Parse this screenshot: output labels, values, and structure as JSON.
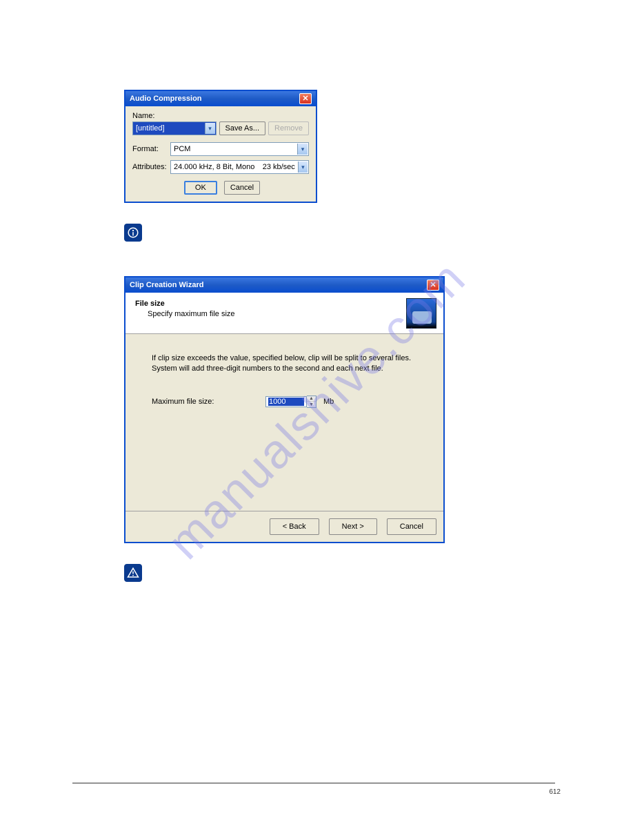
{
  "watermark": "manualshive.com",
  "audio_dialog": {
    "title": "Audio Compression",
    "name_label": "Name:",
    "name_value": "[untitled]",
    "save_as_label": "Save As...",
    "remove_label": "Remove",
    "format_label": "Format:",
    "format_value": "PCM",
    "attributes_label": "Attributes:",
    "attributes_left": "24.000 kHz, 8 Bit, Mono",
    "attributes_right": "23 kb/sec",
    "ok_label": "OK",
    "cancel_label": "Cancel"
  },
  "wizard": {
    "title": "Clip Creation Wizard",
    "header_title": "File size",
    "header_sub": "Specify maximum file size",
    "desc": "If clip size exceeds the value, specified below, clip will be split to several files. System will add three-digit numbers to the second and each next file.",
    "size_label": "Maximum file size:",
    "size_value": "1000",
    "size_unit": "Mb",
    "back_label": "< Back",
    "next_label": "Next >",
    "cancel_label": "Cancel"
  },
  "page_number": "612"
}
